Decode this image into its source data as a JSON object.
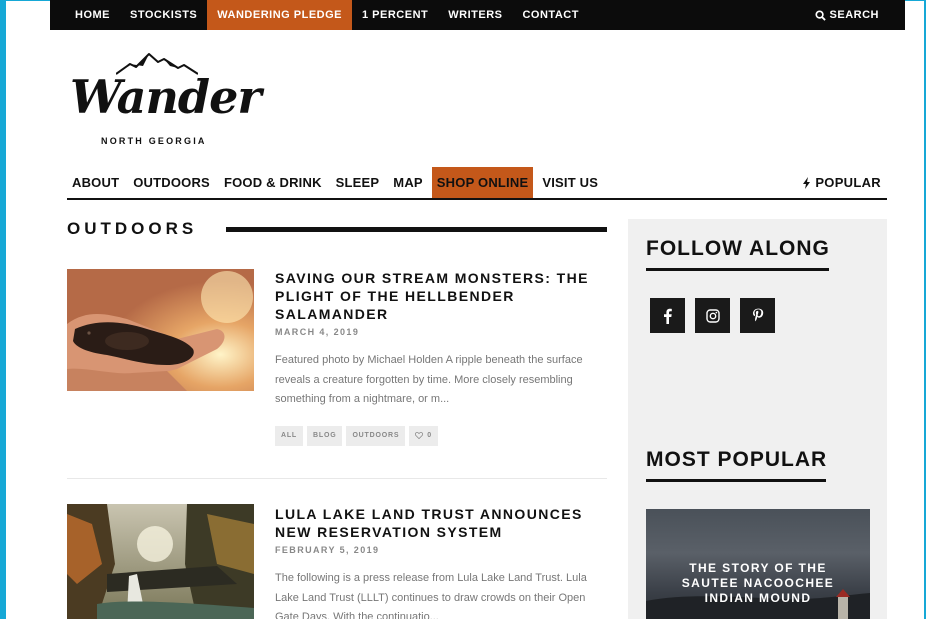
{
  "topnav": {
    "items": [
      {
        "label": "HOME"
      },
      {
        "label": "STOCKISTS"
      },
      {
        "label": "WANDERING PLEDGE",
        "active": true
      },
      {
        "label": "1 PERCENT"
      },
      {
        "label": "WRITERS"
      },
      {
        "label": "CONTACT"
      }
    ],
    "search_label": "SEARCH"
  },
  "logo": {
    "wordmark": "Wander",
    "subtitle": "NORTH GEORGIA"
  },
  "mainnav": {
    "items": [
      {
        "label": "ABOUT"
      },
      {
        "label": "OUTDOORS"
      },
      {
        "label": "FOOD & DRINK"
      },
      {
        "label": "SLEEP"
      },
      {
        "label": "MAP"
      },
      {
        "label": "SHOP ONLINE",
        "active": true
      },
      {
        "label": "VISIT US"
      }
    ],
    "popular_label": "POPULAR"
  },
  "section": {
    "title": "OUTDOORS"
  },
  "articles": [
    {
      "title": "SAVING OUR STREAM MONSTERS: THE PLIGHT OF THE HELLBENDER SALAMANDER",
      "date": "MARCH 4, 2019",
      "excerpt": "Featured photo by Michael Holden  A ripple beneath the surface reveals a creature forgotten by time. More closely resembling something from a nightmare, or m...",
      "tags": [
        "ALL",
        "BLOG",
        "OUTDOORS"
      ],
      "likes": "0"
    },
    {
      "title": "LULA LAKE LAND TRUST ANNOUNCES NEW RESERVATION SYSTEM",
      "date": "FEBRUARY 5, 2019",
      "excerpt": "The following is a press release from Lula Lake Land Trust. Lula Lake Land Trust (LLLT) continues to draw crowds on their Open Gate Days. With the continuatio..."
    }
  ],
  "sidebar": {
    "follow_title": "FOLLOW ALONG",
    "social": [
      "facebook-icon",
      "instagram-icon",
      "pinterest-icon"
    ],
    "popular_title": "MOST POPULAR",
    "popular_post": "THE STORY OF THE SAUTEE NACOOCHEE INDIAN MOUND"
  },
  "colors": {
    "accent": "#c4581a",
    "topbar": "#0c0c0c",
    "sidebar_bg": "#f0f0f0"
  }
}
